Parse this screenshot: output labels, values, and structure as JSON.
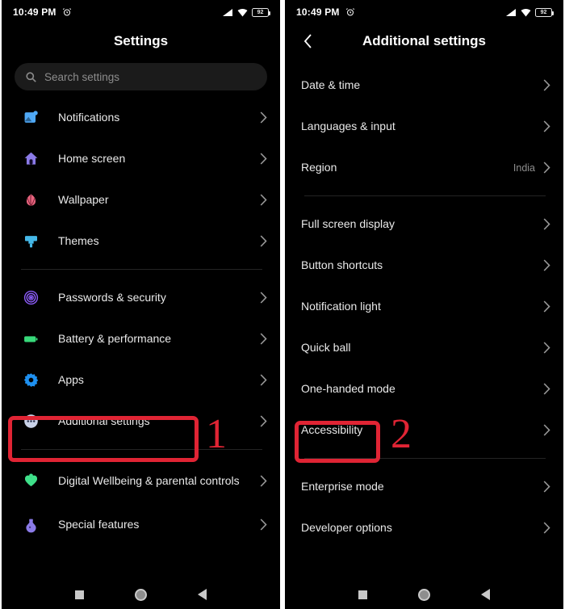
{
  "statusbar": {
    "time": "10:49 PM",
    "alarm_icon": "alarm-clock-icon",
    "signal_icon": "signal-bars-icon",
    "wifi_icon": "wifi-icon",
    "battery_level": "92"
  },
  "left_panel": {
    "title": "Settings",
    "search": {
      "placeholder": "Search settings",
      "icon": "search-icon"
    },
    "groups": [
      {
        "items": [
          {
            "label": "Notifications",
            "icon": "notifications-icon",
            "color": "#4FA8F5"
          },
          {
            "label": "Home screen",
            "icon": "home-icon",
            "color": "#8B7BE8"
          },
          {
            "label": "Wallpaper",
            "icon": "flower-icon",
            "color": "#E8657F"
          },
          {
            "label": "Themes",
            "icon": "paintbrush-icon",
            "color": "#45B8E8"
          }
        ]
      },
      {
        "items": [
          {
            "label": "Passwords & security",
            "icon": "fingerprint-icon",
            "color": "#8B5CF6"
          },
          {
            "label": "Battery & performance",
            "icon": "battery-icon",
            "color": "#38D97A"
          },
          {
            "label": "Apps",
            "icon": "gear-icon",
            "color": "#1E90F0"
          },
          {
            "label": "Additional settings",
            "icon": "dots-circle-icon",
            "color": "#C9D2E8"
          }
        ]
      },
      {
        "items": [
          {
            "label": "Digital Wellbeing & parental controls",
            "icon": "wellbeing-heart-icon",
            "color": "#3FE08A"
          },
          {
            "label": "Special features",
            "icon": "potion-icon",
            "color": "#8B7BE8"
          }
        ]
      }
    ]
  },
  "right_panel": {
    "title": "Additional settings",
    "back_icon": "chevron-left-icon",
    "groups": [
      {
        "items": [
          {
            "label": "Date & time",
            "value": ""
          },
          {
            "label": "Languages & input",
            "value": ""
          },
          {
            "label": "Region",
            "value": "India"
          }
        ]
      },
      {
        "items": [
          {
            "label": "Full screen display",
            "value": ""
          },
          {
            "label": "Button shortcuts",
            "value": ""
          },
          {
            "label": "Notification light",
            "value": ""
          },
          {
            "label": "Quick ball",
            "value": ""
          },
          {
            "label": "One-handed mode",
            "value": ""
          },
          {
            "label": "Accessibility",
            "value": ""
          }
        ]
      },
      {
        "items": [
          {
            "label": "Enterprise mode",
            "value": ""
          },
          {
            "label": "Developer options",
            "value": ""
          }
        ]
      }
    ]
  },
  "navbar": {
    "recents_icon": "recents-square-icon",
    "home_icon": "home-circle-icon",
    "back_icon": "back-triangle-icon"
  },
  "annotations": {
    "color": "#e02434",
    "step1": "1",
    "step2": "2"
  }
}
